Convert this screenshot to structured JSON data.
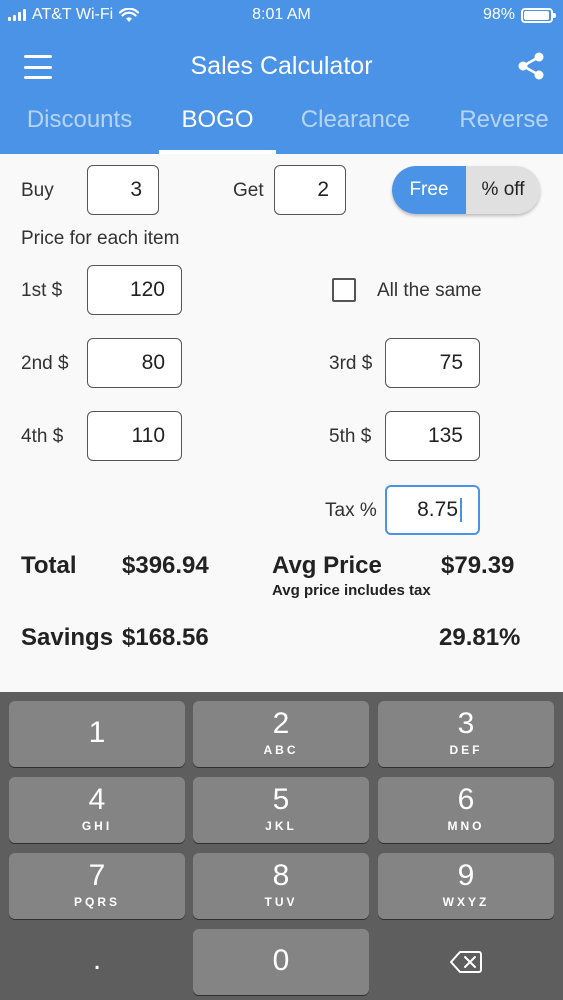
{
  "status": {
    "carrier": "AT&T Wi-Fi",
    "time": "8:01 AM",
    "battery": "98%",
    "battery_level": 0.98
  },
  "appbar": {
    "title": "Sales Calculator"
  },
  "tabs": [
    {
      "label": "Discounts"
    },
    {
      "label": "BOGO"
    },
    {
      "label": "Clearance"
    },
    {
      "label": "Reverse"
    }
  ],
  "form": {
    "buy_label": "Buy",
    "buy_value": "3",
    "get_label": "Get",
    "get_value": "2",
    "mode_free": "Free",
    "mode_percent": "% off",
    "price_header": "Price for each item",
    "item1_label": "1st $",
    "item1_value": "120",
    "item2_label": "2nd $",
    "item2_value": "80",
    "item3_label": "3rd $",
    "item3_value": "75",
    "item4_label": "4th $",
    "item4_value": "110",
    "item5_label": "5th $",
    "item5_value": "135",
    "same_label": "All the same",
    "tax_label": "Tax %",
    "tax_value": "8.75"
  },
  "results": {
    "total_label": "Total",
    "total_value": "$396.94",
    "avg_label": "Avg Price",
    "avg_value": "$79.39",
    "avg_note": "Avg price includes tax",
    "savings_label": "Savings",
    "savings_value": "$168.56",
    "savings_percent": "29.81%"
  },
  "keypad": {
    "keys": [
      {
        "num": "1",
        "letters": ""
      },
      {
        "num": "2",
        "letters": "ABC"
      },
      {
        "num": "3",
        "letters": "DEF"
      },
      {
        "num": "4",
        "letters": "GHI"
      },
      {
        "num": "5",
        "letters": "JKL"
      },
      {
        "num": "6",
        "letters": "MNO"
      },
      {
        "num": "7",
        "letters": "PQRS"
      },
      {
        "num": "8",
        "letters": "TUV"
      },
      {
        "num": "9",
        "letters": "WXYZ"
      },
      {
        "num": "0",
        "letters": ""
      }
    ],
    "decimal": "."
  },
  "colors": {
    "accent": "#4a93e6",
    "keypad_bg": "#5e5e5e",
    "key_bg": "#848484"
  },
  "icons": {
    "menu": "hamburger-icon",
    "share": "share-icon",
    "wifi": "wifi-icon",
    "backspace": "backspace-icon"
  }
}
